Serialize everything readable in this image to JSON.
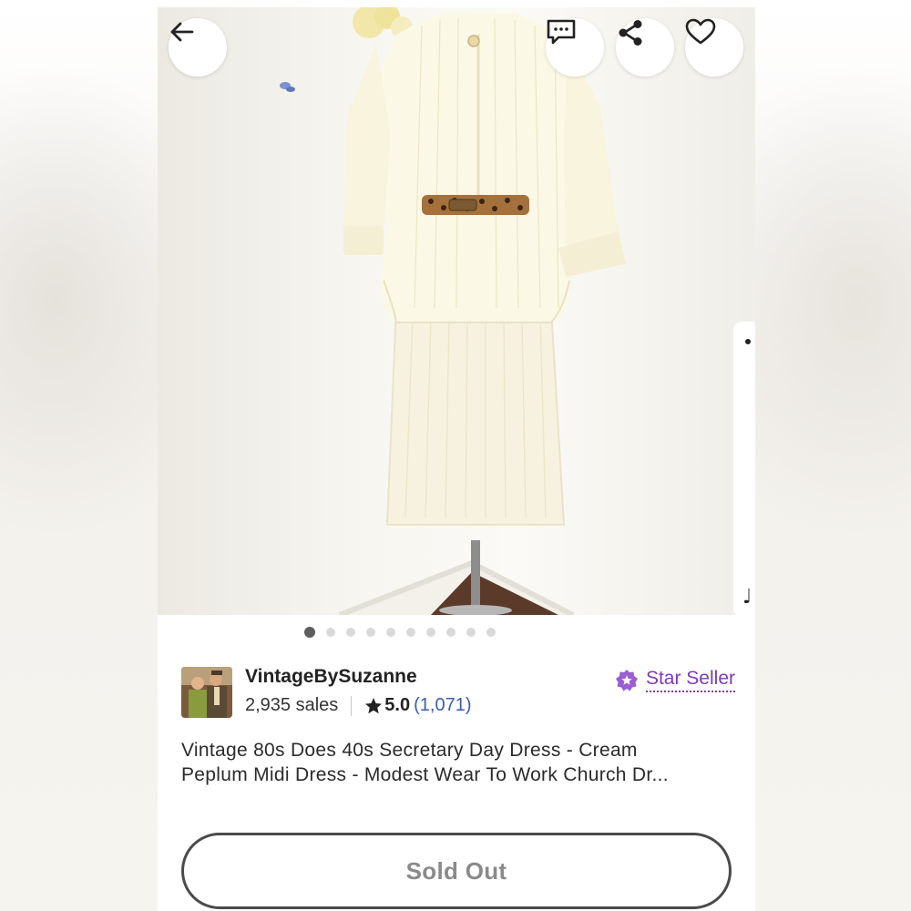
{
  "listing": {
    "image_count": 10,
    "active_image_index": 0,
    "title_line1": "Vintage 80s Does 40s Secretary Day Dress - Cream",
    "title_line2": "Peplum Midi Dress - Modest Wear To Work Church Dr..."
  },
  "toolbar": {
    "back_icon": "arrow-left-icon",
    "message_icon": "message-dots-icon",
    "share_icon": "share-icon",
    "favorite_icon": "heart-outline-icon"
  },
  "shop": {
    "name": "VintageBySuzanne",
    "sales": "2,935 sales",
    "rating": "5.0",
    "review_count": "(1,071)",
    "badge_label": "Star Seller",
    "badge_color": "#7f3ab5"
  },
  "actions": {
    "primary_label": "Sold Out"
  },
  "colors": {
    "link": "#3b5cb0",
    "dot_active": "#5e5e5e",
    "dot_inactive": "#d9d9d9"
  }
}
